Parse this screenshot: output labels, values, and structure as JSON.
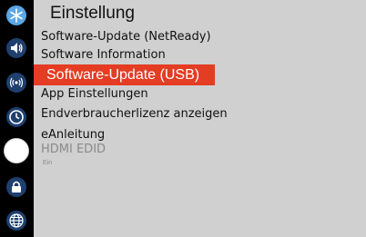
{
  "sidebar": {
    "icons": [
      {
        "name": "snowflake-settings-icon"
      },
      {
        "name": "speaker-sound-icon"
      },
      {
        "name": "network-broadcast-icon"
      },
      {
        "name": "clock-timer-icon"
      },
      {
        "name": "system-setup-icon"
      },
      {
        "name": "lock-icon"
      },
      {
        "name": "globe-language-icon"
      }
    ]
  },
  "menu": {
    "title": "Einstellung",
    "items": [
      {
        "label": "Software-Update (NetReady)"
      },
      {
        "label": "Software Information"
      },
      {
        "label": "Software-Update (USB)"
      },
      {
        "label": "App Einstellungen"
      },
      {
        "label": "Endverbraucherlizenz anzeigen"
      },
      {
        "label": "eAnleitung"
      },
      {
        "label": "HDMI EDID",
        "value": "Ein"
      }
    ]
  },
  "colors": {
    "accent": "#e43d23",
    "panel": "#d0d0d0",
    "sidebar": "#000000"
  }
}
